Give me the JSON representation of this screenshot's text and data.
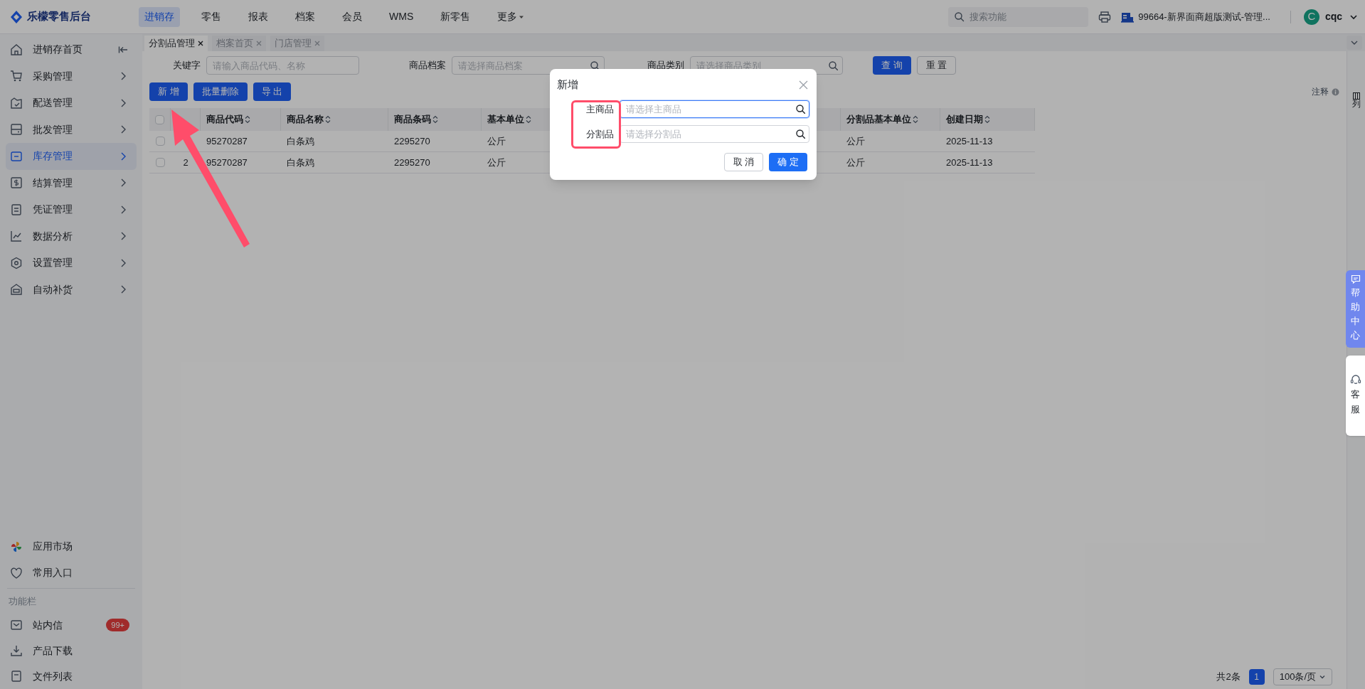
{
  "app": {
    "name": "乐檬零售后台"
  },
  "top_nav": [
    {
      "label": "进销存",
      "selected": true,
      "has_caret": false
    },
    {
      "label": "零售",
      "selected": false,
      "has_caret": false
    },
    {
      "label": "报表",
      "selected": false,
      "has_caret": false
    },
    {
      "label": "档案",
      "selected": false,
      "has_caret": false
    },
    {
      "label": "会员",
      "selected": false,
      "has_caret": false
    },
    {
      "label": "WMS",
      "selected": false,
      "has_caret": false
    },
    {
      "label": "新零售",
      "selected": false,
      "has_caret": false
    },
    {
      "label": "更多",
      "selected": false,
      "has_caret": true
    }
  ],
  "search": {
    "placeholder": "搜索功能"
  },
  "store": {
    "label": "99664-新界面商超版测试-管理..."
  },
  "user": {
    "initial": "C",
    "name": "cqc"
  },
  "sidebar": {
    "items": [
      {
        "label": "进销存首页",
        "selected": false
      },
      {
        "label": "采购管理",
        "selected": false
      },
      {
        "label": "配送管理",
        "selected": false
      },
      {
        "label": "批发管理",
        "selected": false
      },
      {
        "label": "库存管理",
        "selected": true
      },
      {
        "label": "结算管理",
        "selected": false
      },
      {
        "label": "凭证管理",
        "selected": false
      },
      {
        "label": "数据分析",
        "selected": false
      },
      {
        "label": "设置管理",
        "selected": false
      },
      {
        "label": "自动补货",
        "selected": false
      }
    ],
    "shortcuts": [
      {
        "label": "应用市场"
      },
      {
        "label": "常用入口"
      }
    ],
    "section_title": "功能栏",
    "function_items": [
      {
        "label": "站内信",
        "badge": "99+"
      },
      {
        "label": "产品下载"
      },
      {
        "label": "文件列表"
      }
    ]
  },
  "tabs": [
    {
      "label": "分割品管理",
      "selected": true
    },
    {
      "label": "档案首页",
      "selected": false
    },
    {
      "label": "门店管理",
      "selected": false
    }
  ],
  "filters": [
    {
      "label": "关键字",
      "placeholder": "请输入商品代码、名称",
      "kind": "text"
    },
    {
      "label": "商品档案",
      "placeholder": "请选择商品档案",
      "kind": "search"
    },
    {
      "label": "商品类别",
      "placeholder": "请选择商品类别",
      "kind": "search"
    }
  ],
  "query_buttons": [
    {
      "label": "查 询",
      "kind": "primary"
    },
    {
      "label": "重 置",
      "kind": "default"
    }
  ],
  "actions": [
    {
      "label": "新 增"
    },
    {
      "label": "批量删除"
    },
    {
      "label": "导 出"
    }
  ],
  "note": "注释",
  "column_settings": "列",
  "table": {
    "columns": [
      "商品代码",
      "商品名称",
      "商品条码",
      "基本单位",
      "分割品基本单位",
      "创建日期"
    ],
    "all_checked": false,
    "rows": [
      {
        "checked": false,
        "cells": [
          "95270287",
          "白条鸡",
          "2295270",
          "公斤",
          "公斤",
          "2025-11-13"
        ]
      },
      {
        "index": "2",
        "checked": false,
        "cells": [
          "95270287",
          "白条鸡",
          "2295270",
          "公斤",
          "公斤",
          "2025-11-13"
        ]
      }
    ]
  },
  "help": {
    "label": "帮助中心"
  },
  "service": {
    "label": "客服"
  },
  "pagination": {
    "total": "共2条",
    "page": "1",
    "page_size": "100条/页"
  },
  "dialog": {
    "title": "新增",
    "fields": [
      {
        "label": "主商品",
        "placeholder": "请选择主商品",
        "focused": true
      },
      {
        "label": "分割品",
        "placeholder": "请选择分割品",
        "focused": false
      }
    ],
    "buttons": [
      {
        "label": "取 消",
        "kind": "default"
      },
      {
        "label": "确 定",
        "kind": "primary"
      }
    ]
  }
}
